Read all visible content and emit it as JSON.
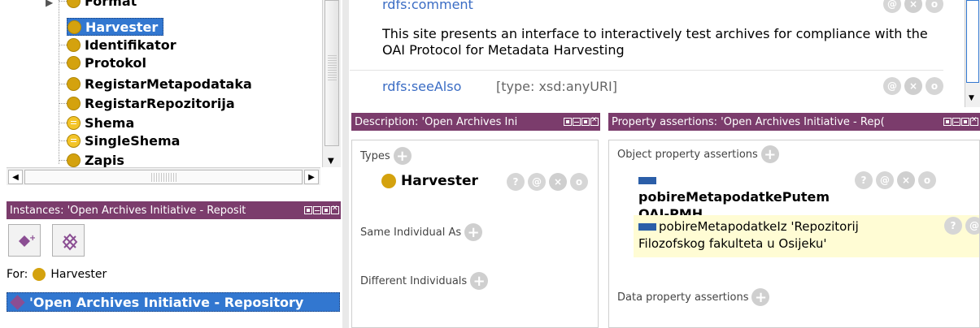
{
  "class_tree": {
    "items": [
      {
        "label": "Format",
        "kind": "class"
      },
      {
        "label": "Harvester",
        "kind": "class",
        "selected": true
      },
      {
        "label": "Identifikator",
        "kind": "class"
      },
      {
        "label": "Protokol",
        "kind": "class"
      },
      {
        "label": "RegistarMetapodataka",
        "kind": "class"
      },
      {
        "label": "RegistarRepozitorija",
        "kind": "class"
      },
      {
        "label": "Shema",
        "kind": "defined"
      },
      {
        "label": "SingleShema",
        "kind": "defined"
      },
      {
        "label": "Zapis",
        "kind": "class"
      }
    ]
  },
  "instances_panel": {
    "title": "Instances: 'Open Archives Initiative - Reposit",
    "for_label": "For:",
    "for_value": "Harvester",
    "selected_individual": "'Open Archives Initiative - Repository"
  },
  "annotations": {
    "comment_property": "rdfs:comment",
    "comment_text": "This site presents an interface to interactively test archives for compliance with the OAI Protocol for Metadata Harvesting",
    "seealso_property": "rdfs:seeAlso",
    "seealso_type": "[type: xsd:anyURI]"
  },
  "description_panel": {
    "title": "Description: 'Open Archives Ini",
    "types_label": "Types",
    "type_value": "Harvester",
    "same_label": "Same Individual As",
    "different_label": "Different Individuals"
  },
  "property_panel": {
    "title": "Property assertions: 'Open Archives Initiative - Rep(",
    "object_label": "Object property assertions",
    "obj1_line1": "pobireMetapodatkePutem",
    "obj1_line2": "OAI-PMH",
    "obj2_line1": "pobireMetapodatkeIz  'Repozitorij",
    "obj2_line2": "Filozofskog fakulteta u Osijeku'",
    "data_label": "Data property assertions"
  },
  "buttons": {
    "plus": "+",
    "help": "?",
    "at": "@",
    "delete": "×",
    "edit": "o"
  }
}
